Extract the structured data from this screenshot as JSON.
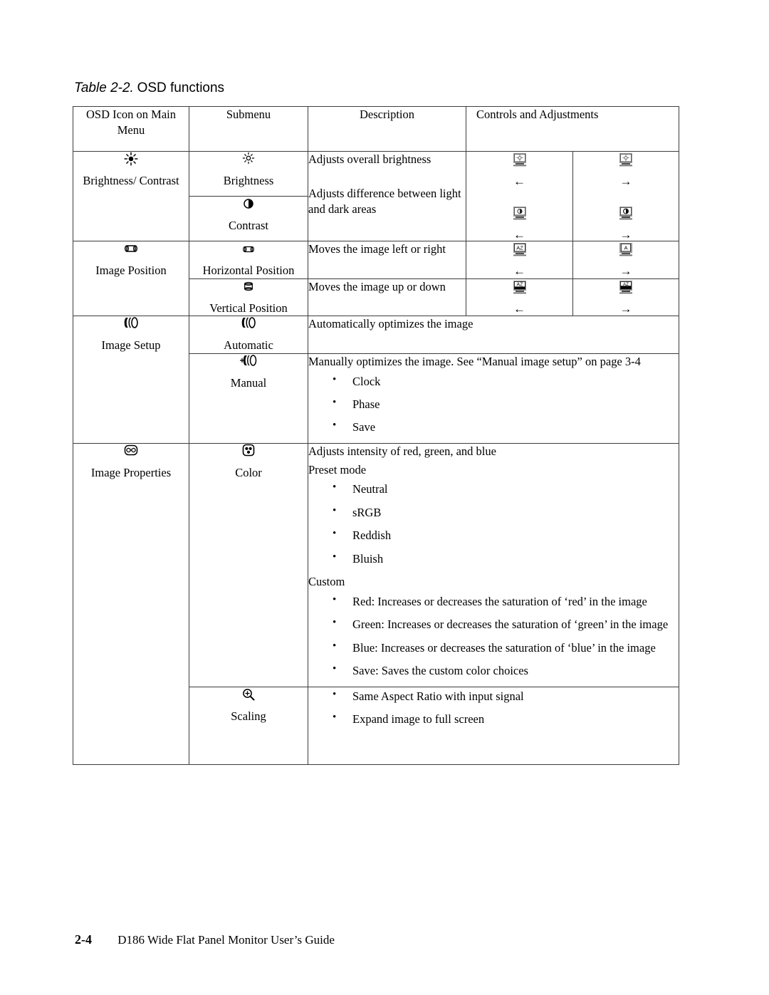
{
  "caption": {
    "number": "Table 2-2.",
    "text": "OSD functions"
  },
  "table": {
    "headers": {
      "col1": "OSD Icon on Main Menu",
      "col2": "Submenu",
      "col3": "Description",
      "col4": "Controls and Adjustments"
    },
    "rows": [
      {
        "menu_label": "Brightness/ Contrast",
        "menu_icon": "sun-icon",
        "submenus": [
          {
            "label": "Brightness",
            "icon": "sun-icon",
            "description": "Adjusts overall brightness",
            "control_left": {
              "icon": "monitor-brightness-icon",
              "arrow": "←"
            },
            "control_right": {
              "icon": "monitor-brightness-icon",
              "arrow": "→"
            }
          },
          {
            "label": "Contrast",
            "icon": "half-circle-icon",
            "description": "Adjusts difference between light and dark areas",
            "control_left": {
              "icon": "monitor-contrast-icon",
              "arrow": "←"
            },
            "control_right": {
              "icon": "monitor-contrast-icon",
              "arrow": "→"
            }
          }
        ]
      },
      {
        "menu_label": "Image Position",
        "menu_icon": "horizontal-cylinder-icon",
        "submenus": [
          {
            "label": "Horizontal Position",
            "icon": "horizontal-cylinder-icon",
            "description": "Moves the image left or right",
            "control_left": {
              "icon": "monitor-az-horizontal-icon",
              "arrow": "←"
            },
            "control_right": {
              "icon": "monitor-az-horizontal-icon",
              "arrow": "→"
            }
          },
          {
            "label": "Vertical Position",
            "icon": "vertical-cylinder-icon",
            "description": "Moves the image up or down",
            "control_left": {
              "icon": "monitor-az-vertical-icon",
              "arrow": "←"
            },
            "control_right": {
              "icon": "monitor-az-vertical-icon",
              "arrow": "→"
            }
          }
        ]
      },
      {
        "menu_label": "Image Setup",
        "menu_icon": "image-setup-icon",
        "submenus": [
          {
            "label": "Automatic",
            "icon": "image-setup-icon",
            "description": "Automatically optimizes the image"
          },
          {
            "label": "Manual",
            "icon": "image-setup-manual-icon",
            "description": "Manually optimizes the image. See “Manual image setup” on page 3-4",
            "bullets": [
              "Clock",
              "Phase",
              "Save"
            ]
          }
        ]
      },
      {
        "menu_label": "Image Properties",
        "menu_icon": "image-properties-icon",
        "submenus": [
          {
            "label": "Color",
            "icon": "color-dots-icon",
            "description": "Adjusts intensity of red, green, and blue",
            "preset_heading": "Preset mode",
            "preset_bullets": [
              "Neutral",
              "sRGB",
              "Reddish",
              "Bluish"
            ],
            "custom_heading": "Custom",
            "custom_bullets": [
              "Red: Increases or decreases the saturation of ‘red’ in the image",
              "Green: Increases or decreases the saturation of ‘green’ in the image",
              "Blue: Increases or decreases the saturation of ‘blue’ in the image",
              "Save: Saves the custom color choices"
            ]
          },
          {
            "label": "Scaling",
            "icon": "magnifier-plus-icon",
            "bullets": [
              "Same Aspect Ratio with input signal",
              "Expand image to full screen"
            ]
          }
        ]
      }
    ]
  },
  "footer": {
    "page_number": "2-4",
    "guide_title": "D186 Wide Flat Panel Monitor User’s Guide"
  }
}
